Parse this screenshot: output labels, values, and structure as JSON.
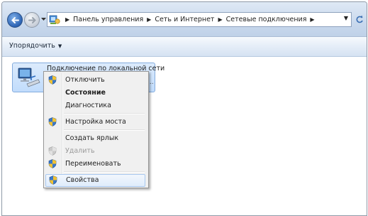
{
  "address_bar": {
    "back_icon": "back-arrow-icon",
    "forward_icon": "forward-arrow-icon",
    "location_icon": "control-panel-icon",
    "crumbs": [
      "Панель управления",
      "Сеть и Интернет",
      "Сетевые подключения"
    ]
  },
  "toolbar": {
    "organize_label": "Упорядочить"
  },
  "connection": {
    "name": "Подключение по локальной сети",
    "more": "...",
    "icon": "network-adapter-icon"
  },
  "context_menu": {
    "items": [
      {
        "label": "Отключить",
        "icon": "uac-shield-icon"
      },
      {
        "label": "Состояние",
        "bold": true
      },
      {
        "label": "Диагностика"
      },
      {
        "label": "Настройка моста",
        "icon": "uac-shield-icon"
      },
      {
        "label": "Создать ярлык"
      },
      {
        "label": "Удалить",
        "icon": "uac-shield-icon",
        "disabled": true
      },
      {
        "label": "Переименовать",
        "icon": "uac-shield-icon"
      },
      {
        "label": "Свойства",
        "icon": "uac-shield-icon",
        "highlighted": true
      }
    ]
  },
  "colors": {
    "accent": "#2c63b3",
    "selection": "#c1dcfc",
    "menu_bg": "#f0f0f0"
  }
}
